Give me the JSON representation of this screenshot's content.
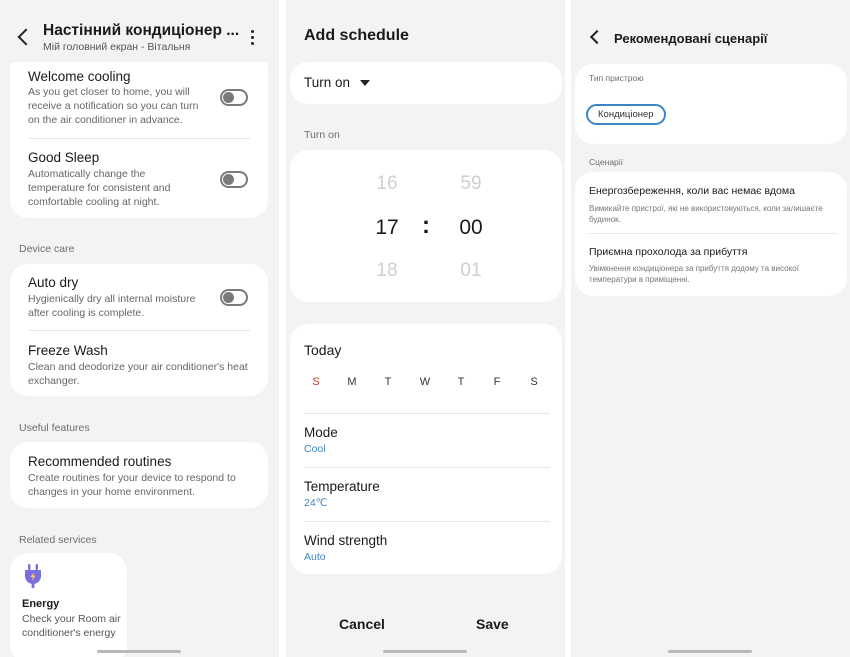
{
  "screen1": {
    "header": {
      "title": "Настінний кондиціонер ...",
      "subtitle": "Мій головний екран - Вітальня"
    },
    "welcome_cooling": {
      "title": "Welcome cooling",
      "desc": "As you get closer to home, you will receive a notification so you can turn on the air conditioner in advance.",
      "enabled": false
    },
    "good_sleep": {
      "title": "Good Sleep",
      "desc": "Automatically change the temperature for consistent and comfortable cooling at night.",
      "enabled": false
    },
    "device_care_label": "Device care",
    "auto_dry": {
      "title": "Auto dry",
      "desc": "Hygienically dry all internal moisture after cooling is complete.",
      "enabled": false
    },
    "freeze_wash": {
      "title": "Freeze Wash",
      "desc": "Clean and deodorize your air conditioner's heat exchanger."
    },
    "useful_features_label": "Useful features",
    "recommended_routines": {
      "title": "Recommended routines",
      "desc": "Create routines for your device to respond to changes in your home environment."
    },
    "related_services_label": "Related services",
    "energy": {
      "title": "Energy",
      "desc": "Check your Room air conditioner's energy"
    }
  },
  "screen2": {
    "title": "Add schedule",
    "action_select": "Turn on",
    "turn_on_label": "Turn on",
    "time": {
      "hour_prev": "16",
      "hour": "17",
      "hour_next": "18",
      "separator": ":",
      "min_prev": "59",
      "min": "00",
      "min_next": "01"
    },
    "today_label": "Today",
    "days": [
      "S",
      "M",
      "T",
      "W",
      "T",
      "F",
      "S"
    ],
    "mode": {
      "label": "Mode",
      "value": "Cool"
    },
    "temperature": {
      "label": "Temperature",
      "value": "24℃"
    },
    "wind": {
      "label": "Wind strength",
      "value": "Auto"
    },
    "cancel": "Cancel",
    "save": "Save"
  },
  "screen3": {
    "title": "Рекомендовані сценарії",
    "device_type_label": "Тип пристрою",
    "chip": "Кондиціонер",
    "scenarios_label": "Сценарії",
    "scenario1": {
      "title": "Енергозбереження, коли вас немає вдома",
      "desc": "Вимикайте пристрої, які не використовуються, коли залишаєте будинок."
    },
    "scenario2": {
      "title": "Приємна прохолода за прибуття",
      "desc": "Увімкнення кондиціонера за прибуття додому та високої температури в приміщенні."
    }
  },
  "colors": {
    "accent_blue": "#3b86c6",
    "sunday_red": "#c4342b",
    "background": "#f3f3f5",
    "card": "#ffffff",
    "energy_icon": "#7b6fe0"
  }
}
